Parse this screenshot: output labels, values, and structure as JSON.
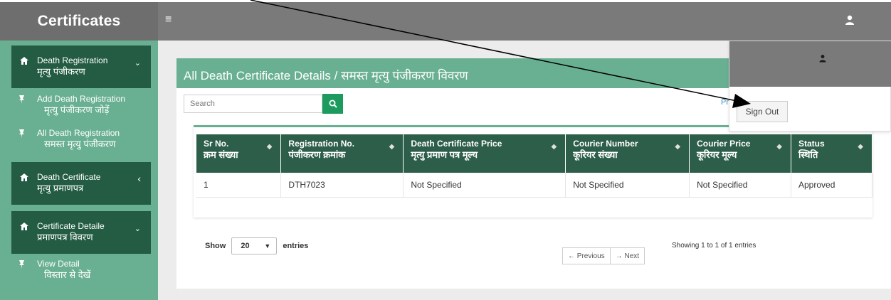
{
  "app": {
    "brand": "Certificates"
  },
  "topbar": {
    "menu_icon": "hamburger-icon",
    "user_icon": "user-icon"
  },
  "sidebar": {
    "groups": [
      {
        "label_en": "Death Registration",
        "label_hi": "मृत्यु पंजीकरण",
        "icon": "home-icon",
        "caret": "⌄"
      },
      {
        "label_en": "Death Certificate",
        "label_hi": "मृत्यु प्रमाणपत्र",
        "icon": "home-icon",
        "caret": "‹"
      },
      {
        "label_en": "Certificate Detaile",
        "label_hi": "प्रमाणपत्र विवरण",
        "icon": "home-icon",
        "caret": "⌄"
      }
    ],
    "subitems": [
      {
        "label_en": "Add Death Registration",
        "label_hi": "मृत्यु पंजीकरण जोड़ें",
        "icon": "pin-icon"
      },
      {
        "label_en": "All Death Registration",
        "label_hi": "समस्त मृत्यु पंजीकरण",
        "icon": "pin-icon"
      },
      {
        "label_en": "View Detail",
        "label_hi": "विस्तार से देखें",
        "icon": "pin-icon"
      }
    ]
  },
  "main": {
    "title": "All Death Certificate Details / समस्त मृत्यु पंजीकरण विवरण",
    "search_placeholder": "Search",
    "table": {
      "columns": [
        {
          "en": "Sr No.",
          "hi": "क्रम संख्या"
        },
        {
          "en": "Registration No.",
          "hi": "पंजीकरण क्रमांक"
        },
        {
          "en": "Death Certificate Price",
          "hi": "मृत्यु प्रमाण पत्र मूल्य"
        },
        {
          "en": "Courier Number",
          "hi": "कूरियर संख्या"
        },
        {
          "en": "Courier Price",
          "hi": "कूरियर मूल्य"
        },
        {
          "en": "Status",
          "hi": "स्थिति"
        }
      ],
      "rows": [
        [
          "1",
          "DTH7023",
          "Not Specified",
          "Not Specified",
          "Not Specified",
          "Approved"
        ]
      ]
    },
    "show_label": "Show",
    "entries_value": "20",
    "entries_label": "entries",
    "prev_label": "← Previous",
    "next_label": "→ Next",
    "showing_text": "Showing 1 to 1 of 1 entries"
  },
  "dropdown": {
    "signout_label": "Sign Out",
    "partial_text": "Pr"
  },
  "colors": {
    "sidebar_bg": "#69b092",
    "nav_dark": "#235c43",
    "header_green": "#69b092",
    "table_head": "#2d5e49",
    "search_btn": "#1d9b5e",
    "topbar": "#7a7a7a"
  }
}
